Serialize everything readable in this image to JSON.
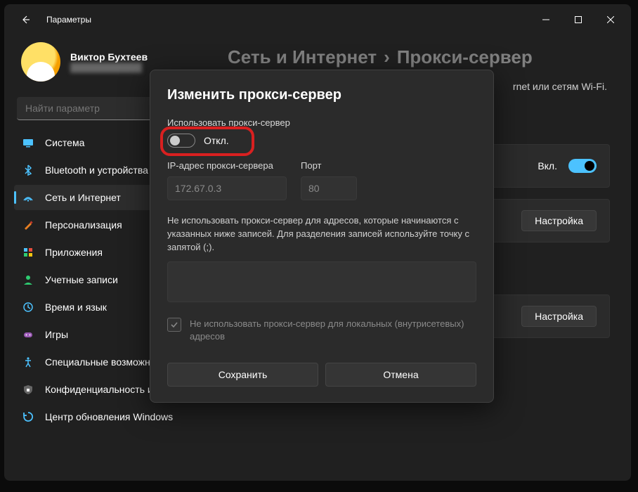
{
  "titlebar": {
    "title": "Параметры"
  },
  "profile": {
    "name": "Виктор Бухтеев",
    "email": "████████████"
  },
  "search": {
    "placeholder": "Найти параметр"
  },
  "nav": {
    "items": [
      {
        "label": "Система",
        "icon": "system"
      },
      {
        "label": "Bluetooth и устройства",
        "icon": "bluetooth"
      },
      {
        "label": "Сеть и Интернет",
        "icon": "network",
        "active": true
      },
      {
        "label": "Персонализация",
        "icon": "personalization"
      },
      {
        "label": "Приложения",
        "icon": "apps"
      },
      {
        "label": "Учетные записи",
        "icon": "accounts"
      },
      {
        "label": "Время и язык",
        "icon": "time"
      },
      {
        "label": "Игры",
        "icon": "gaming"
      },
      {
        "label": "Специальные возможности",
        "icon": "accessibility"
      },
      {
        "label": "Конфиденциальность и защита",
        "icon": "privacy"
      },
      {
        "label": "Центр обновления Windows",
        "icon": "update"
      }
    ]
  },
  "breadcrumb": {
    "parent": "Сеть и Интернет",
    "current": "Прокси-сервер"
  },
  "content": {
    "subtitle_fragment": "rnet или сетям Wi-Fi.",
    "row1_toggle_label": "Вкл.",
    "row_button": "Настройка"
  },
  "dialog": {
    "title": "Изменить прокси-сервер",
    "use_proxy_label": "Использовать прокси-сервер",
    "toggle_state": "Откл.",
    "ip_label": "IP-адрес прокси-сервера",
    "ip_value": "172.67.0.3",
    "port_label": "Порт",
    "port_value": "80",
    "exceptions_note": "Не использовать прокси-сервер для адресов, которые начинаются с указанных ниже записей. Для разделения записей используйте точку с запятой (;).",
    "local_checkbox_label": "Не использовать прокси-сервер для локальных (внутрисетевых) адресов",
    "save": "Сохранить",
    "cancel": "Отмена"
  }
}
